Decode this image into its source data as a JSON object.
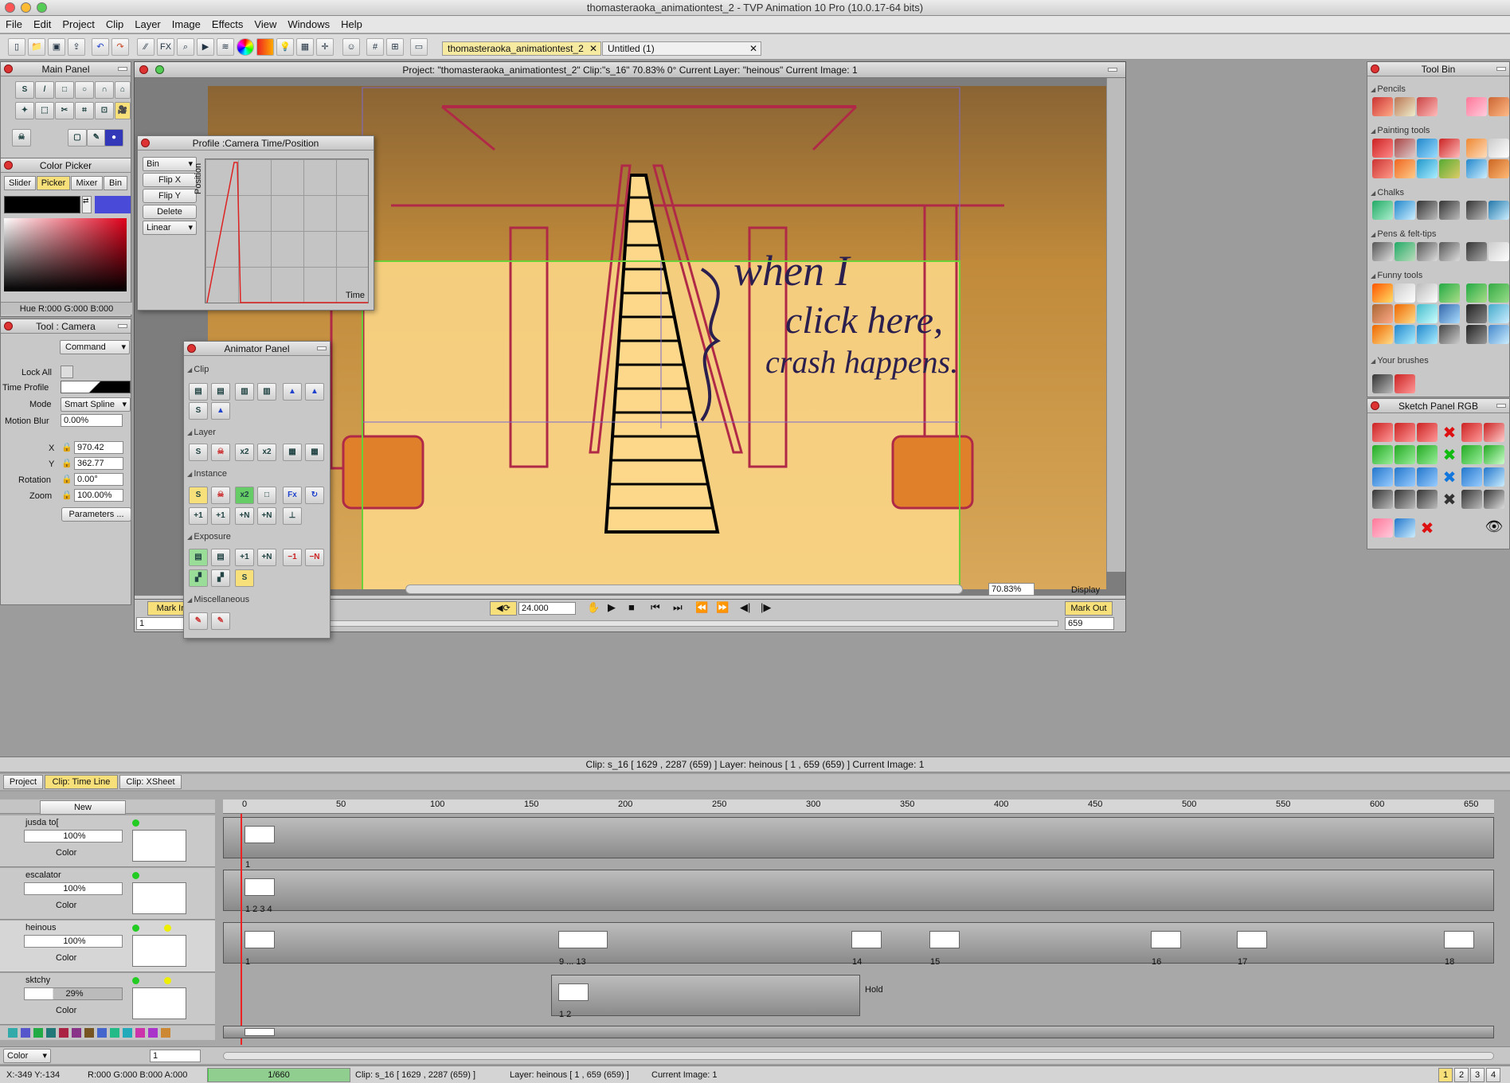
{
  "window": {
    "title": "thomasteraoka_animationtest_2 - TVP Animation 10 Pro (10.0.17-64 bits)"
  },
  "menu": [
    "File",
    "Edit",
    "Project",
    "Clip",
    "Layer",
    "Image",
    "Effects",
    "View",
    "Windows",
    "Help"
  ],
  "tabs": [
    {
      "label": "thomasteraoka_animationtest_2",
      "active": true
    },
    {
      "label": "Untitled (1)",
      "active": false
    }
  ],
  "main_panel": {
    "title": "Main Panel"
  },
  "color_picker": {
    "title": "Color Picker",
    "tabs": [
      "Slider",
      "Picker",
      "Mixer",
      "Bin"
    ],
    "active_tab": "Picker",
    "readout": "Hue R:000 G:000 B:000"
  },
  "tool_camera": {
    "title": "Tool : Camera",
    "mode_dropdown": "Command",
    "lock_all": "Lock All",
    "time_profile": "Time Profile",
    "mode_label": "Mode",
    "mode": "Smart Spline",
    "motion_blur_label": "Motion Blur",
    "motion_blur": "0.00%",
    "x_label": "X",
    "x": "970.42",
    "y_label": "Y",
    "y": "362.77",
    "rotation_label": "Rotation",
    "rotation": "0.00°",
    "zoom_label": "Zoom",
    "zoom": "100.00%",
    "params": "Parameters ..."
  },
  "profile": {
    "title": "Profile :Camera Time/Position",
    "bin": "Bin",
    "flipx": "Flip X",
    "flipy": "Flip Y",
    "delete": "Delete",
    "interp": "Linear",
    "ylabel": "Position",
    "xlabel": "Time"
  },
  "animator": {
    "title": "Animator Panel",
    "sections": [
      "Clip",
      "Layer",
      "Instance",
      "Exposure",
      "Miscellaneous"
    ]
  },
  "canvas_info": {
    "project": "Project:  \"thomasteraoka_animationtest_2\"  Clip:\"s_16\"  70.83%  0°  Current Layer: \"heinous\"  Current Image: 1"
  },
  "sketch_text": {
    "line1": "when I",
    "line2": "click here,",
    "line3": "crash happens."
  },
  "canvas_footer": {
    "zoom": "70.83%",
    "display": "Display",
    "mark_in": "Mark In",
    "mark_out": "Mark Out",
    "fps": "24.000",
    "start_frame": "1",
    "end_frame": "659"
  },
  "tool_bin": {
    "title": "Tool Bin",
    "sections": [
      "Pencils",
      "Painting tools",
      "Chalks",
      "Pens & felt-tips",
      "Funny tools",
      "Your brushes"
    ]
  },
  "sketch_panel": {
    "title": "Sketch Panel RGB"
  },
  "timeline": {
    "header": "Clip: s_16 [ 1629 , 2287  (659) ]      Layer: heinous [ 1 , 659  (659) ]    Current Image: 1",
    "tabs": [
      "Project",
      "Clip: Time Line",
      "Clip: XSheet"
    ],
    "active_tab": "Clip: Time Line",
    "new_btn": "New",
    "ruler": [
      "0",
      "50",
      "100",
      "150",
      "200",
      "250",
      "300",
      "350",
      "400",
      "450",
      "500",
      "550",
      "600",
      "650"
    ],
    "layers": [
      {
        "name": "jusda to[",
        "opacity": "100%",
        "mode": "Color",
        "frames": [
          "1"
        ]
      },
      {
        "name": "escalator",
        "opacity": "100%",
        "mode": "Color",
        "frames": [
          "1 2 3 4"
        ]
      },
      {
        "name": "heinous",
        "opacity": "100%",
        "mode": "Color",
        "frames": [
          "1",
          "9 ... 13",
          "14",
          "15",
          "16",
          "17",
          "18"
        ]
      },
      {
        "name": "sktchy",
        "opacity": "29%",
        "mode": "Color",
        "frames": [
          "1 2"
        ],
        "hold": "Hold"
      }
    ],
    "bottom_mode": "Color",
    "bottom_field": "1"
  },
  "status": {
    "coords": "X:-349  Y:-134",
    "rgba": "R:000 G:000 B:000 A:000",
    "progress_text": "1/660",
    "progress": 0.0015,
    "clip": "Clip: s_16 [ 1629 , 2287  (659) ]",
    "layer": "Layer: heinous [ 1 , 659  (659) ]",
    "image": "Current Image: 1",
    "pages": [
      "1",
      "2",
      "3",
      "4"
    ]
  },
  "colors": {
    "accent": "#f2e07a",
    "canvas_bg": "#c08a3a",
    "canvas_light": "#fdd88a",
    "sketch": "#b02a48",
    "ink": "#2a1f4e"
  }
}
